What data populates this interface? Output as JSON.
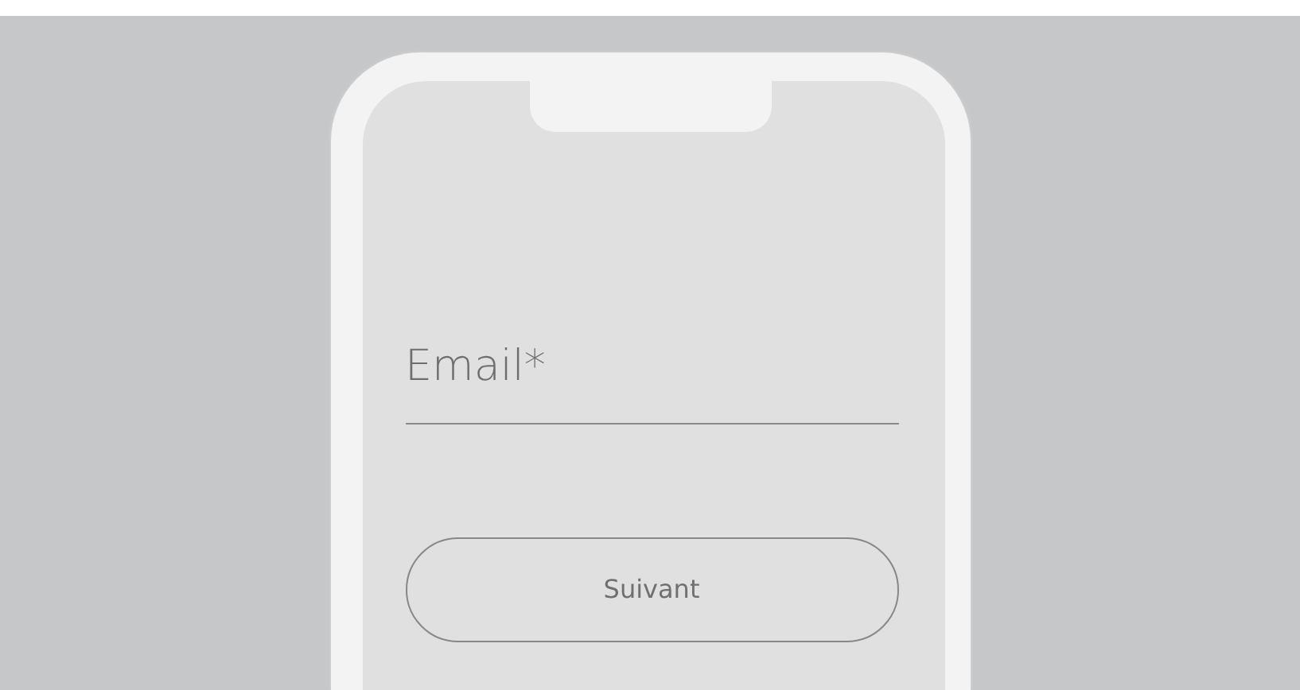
{
  "email_field": {
    "placeholder": "Email*"
  },
  "next_button": {
    "label": "Suivant"
  }
}
